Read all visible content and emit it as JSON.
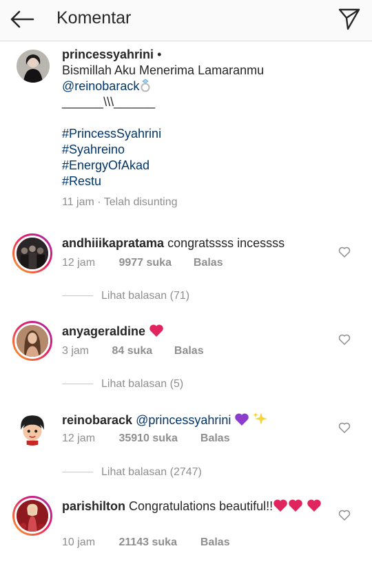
{
  "header": {
    "title": "Komentar",
    "back_icon": "arrow-left-icon",
    "send_icon": "paper-plane-icon"
  },
  "post": {
    "username": "princessyahrini",
    "bullet": "•",
    "caption_line1": "Bismillah Aku Menerima Lamaranmu",
    "mention": "@reinobarack",
    "divider_line": "______\\\\\\______",
    "hashtags": [
      "#PrincessSyahrini",
      "#Syahreino",
      "#EnergyOfAkad",
      "#Restu"
    ],
    "meta": "11 jam · Telah disunting"
  },
  "comments": [
    {
      "username": "andhiiikapratama",
      "text": "congratssss incessss",
      "time": "12 jam",
      "likes": "9977 suka",
      "reply_label": "Balas",
      "view_replies": "Lihat balasan (71)"
    },
    {
      "username": "anyageraldine",
      "text": "",
      "time": "3 jam",
      "likes": "84 suka",
      "reply_label": "Balas",
      "view_replies": "Lihat balasan (5)"
    },
    {
      "username": "reinobarack",
      "text": "@princessyahrini",
      "time": "12 jam",
      "likes": "35910 suka",
      "reply_label": "Balas",
      "view_replies": "Lihat balasan (2747)"
    },
    {
      "username": "parishilton",
      "text": "Congratulations beautiful!!",
      "time": "10 jam",
      "likes": "21143 suka",
      "reply_label": "Balas"
    }
  ],
  "colors": {
    "link": "#003569",
    "meta": "#8e8e8e",
    "heart_red": "#e0245e",
    "purple_heart": "#8e3ccb"
  }
}
